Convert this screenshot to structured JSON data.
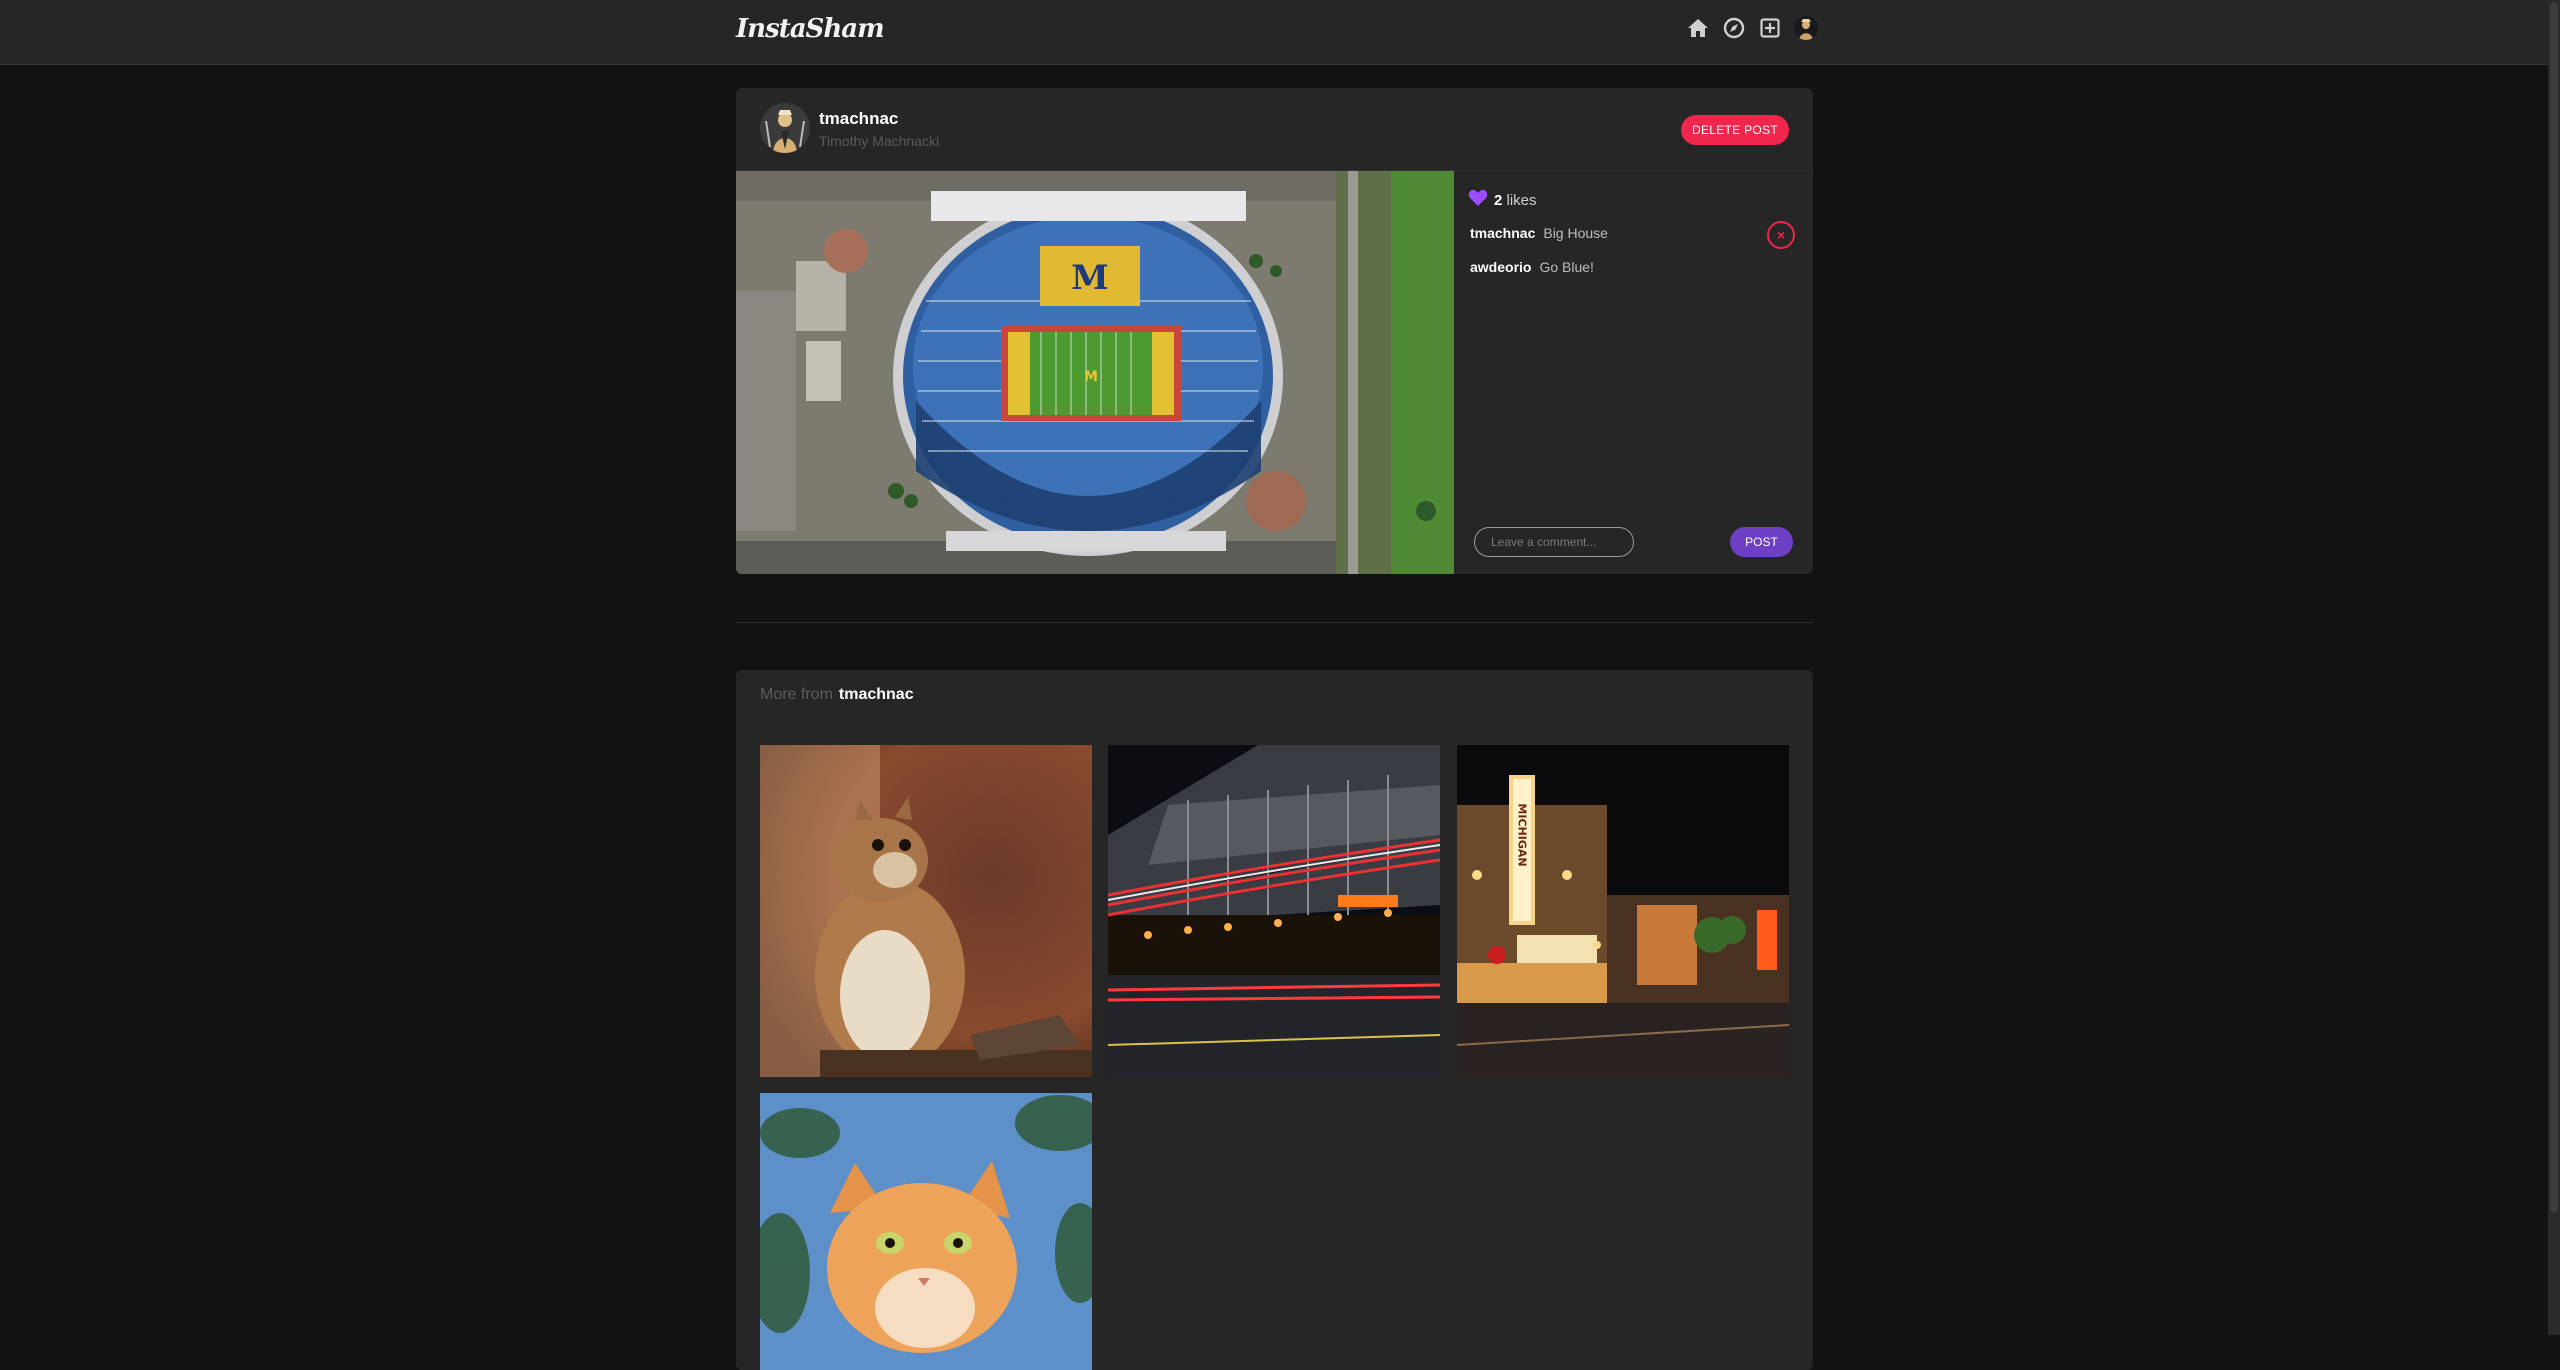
{
  "app": {
    "logo_text": "InstaSham"
  },
  "nav": {
    "icons": [
      "home-icon",
      "explore-icon",
      "new-post-icon",
      "profile-avatar"
    ]
  },
  "post": {
    "username": "tmachnac",
    "fullname": "Timothy Machnacki",
    "delete_label": "DELETE POST",
    "likes_count": "2",
    "likes_label": "likes",
    "comments": [
      {
        "user": "tmachnac",
        "text": "Big House"
      },
      {
        "user": "awdeorio",
        "text": "Go Blue!"
      }
    ],
    "comment_placeholder": "Leave a comment...",
    "post_button": "POST"
  },
  "more": {
    "prefix": "More from",
    "username": "tmachnac"
  },
  "colors": {
    "accent_red": "#f0264d",
    "accent_purple": "#6c3fc4",
    "heart": "#9b4dff",
    "background": "#121212",
    "card": "#262626"
  }
}
